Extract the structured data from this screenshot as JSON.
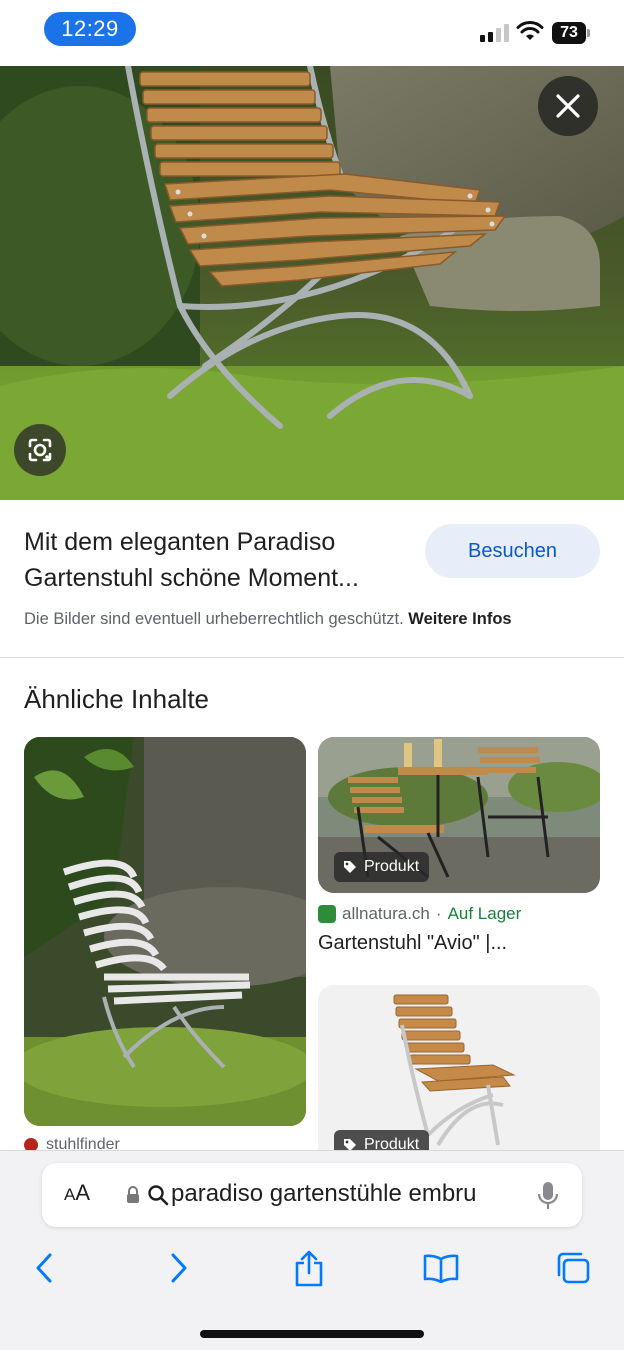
{
  "status_bar": {
    "time": "12:29",
    "battery": "73",
    "icons": [
      "signal-icon",
      "wifi-icon",
      "battery-icon"
    ]
  },
  "hero": {
    "icons": [
      "close-icon",
      "google-lens-icon"
    ]
  },
  "result": {
    "title": "Mit dem eleganten Paradiso Gartenstuhl schöne Moment...",
    "visit_button": "Besuchen",
    "copyright_text": "Die Bilder sind eventuell urheberrechtlich geschützt.",
    "more_info_link": "Weitere Infos"
  },
  "similar": {
    "heading": "Ähnliche Inhalte",
    "cards": [
      {
        "source": "stuhlfinder"
      },
      {
        "badge": "Produkt",
        "source": "allnatura.ch",
        "separator": "·",
        "availability": "Auf Lager",
        "title": "Gartenstuhl \"Avio\" |..."
      },
      {
        "badge": "Produkt"
      }
    ]
  },
  "browser": {
    "text_size_label_small": "A",
    "text_size_label_large": "A",
    "url": "paradiso gartenstühle embru",
    "icons": [
      "lock-icon",
      "search-icon",
      "microphone-icon",
      "back-icon",
      "forward-icon",
      "share-icon",
      "bookmarks-icon",
      "tabs-icon"
    ]
  },
  "colors": {
    "accent": "#1a73e8",
    "visit_button_bg": "#e8eef9",
    "visit_button_text": "#0b57d0",
    "in_stock": "#188038",
    "ios_blue": "#007aff"
  }
}
